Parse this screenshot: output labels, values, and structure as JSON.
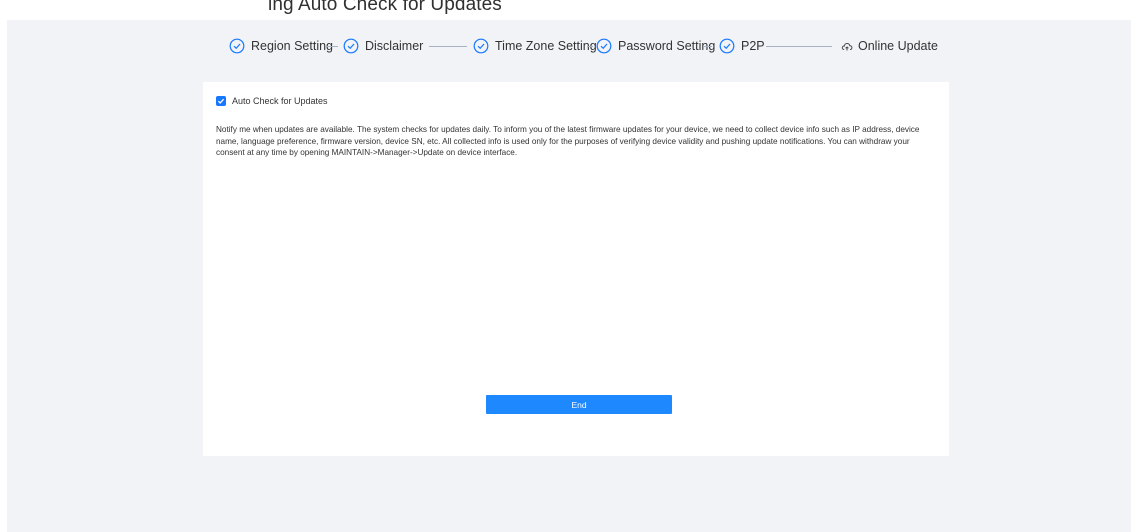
{
  "header_fragment": "ing                Auto Check for Updates",
  "stepper": {
    "steps": [
      {
        "label": "Region Setting",
        "status": "done"
      },
      {
        "label": "Disclaimer",
        "status": "done"
      },
      {
        "label": "Time Zone Setting",
        "status": "done"
      },
      {
        "label": "Password Setting",
        "status": "done"
      },
      {
        "label": "P2P",
        "status": "done"
      },
      {
        "label": "Online Update",
        "status": "current"
      }
    ]
  },
  "auto_check": {
    "label": "Auto Check for Updates",
    "checked": true
  },
  "notice": "Notify me when updates are available. The system checks for updates daily. To inform you of the latest firmware updates for your device, we need to collect device info such as IP address, device name, language preference, firmware version, device SN, etc. All collected info is used only for the purposes of verifying device validity and pushing update notifications. You can withdraw your consent at any time by opening MAINTAIN->Manager->Update on device interface.",
  "end_button": {
    "label": "End"
  },
  "colors": {
    "accent": "#1e88ff",
    "step_icon": "#1677ff",
    "background": "#f1f3f7"
  }
}
